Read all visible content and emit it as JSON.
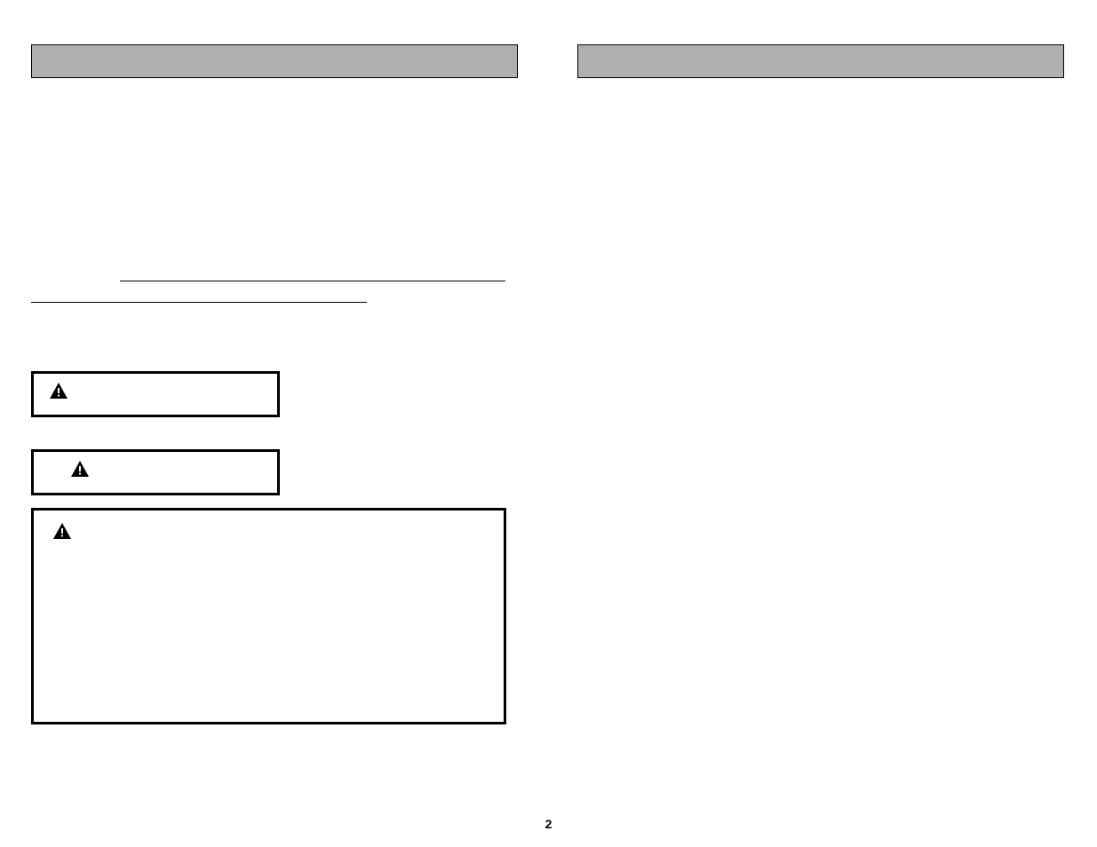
{
  "page_number": "2",
  "left_column": {
    "header_label": "",
    "warning_small_1_label": "",
    "warning_small_2_label": "",
    "warning_large_label": ""
  },
  "right_column": {
    "header_label": ""
  },
  "icons": {
    "alert": "alert-triangle"
  }
}
